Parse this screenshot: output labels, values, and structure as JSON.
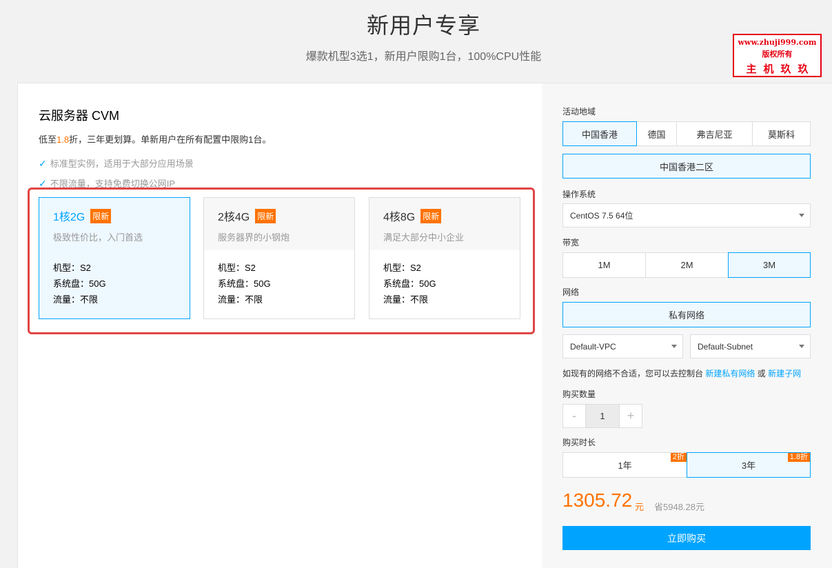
{
  "hero": {
    "title": "新用户专享",
    "subtitle": "爆款机型3选1，新用户限购1台，100%CPU性能"
  },
  "watermark": {
    "line1": "www.zhuji999.com",
    "line2": "版权所有",
    "line3": "主机玖玖"
  },
  "product": {
    "title": "云服务器 CVM",
    "desc_pre": "低至",
    "desc_discount": "1.8",
    "desc_post": "折，三年更划算。单新用户在所有配置中限购1台。",
    "features": [
      "标准型实例，适用于大部分应用场景",
      "不限流量，支持免费切换公网IP"
    ]
  },
  "packages": [
    {
      "name": "1核2G",
      "badge": "限新",
      "subtitle": "极致性价比，入门首选",
      "model": "机型：S2",
      "disk": "系统盘：50G",
      "traffic": "流量：不限",
      "selected": true
    },
    {
      "name": "2核4G",
      "badge": "限新",
      "subtitle": "服务器界的小钢炮",
      "model": "机型：S2",
      "disk": "系统盘：50G",
      "traffic": "流量：不限",
      "selected": false
    },
    {
      "name": "4核8G",
      "badge": "限新",
      "subtitle": "满足大部分中小企业",
      "model": "机型：S2",
      "disk": "系统盘：50G",
      "traffic": "流量：不限",
      "selected": false
    }
  ],
  "config": {
    "region_label": "活动地域",
    "regions": [
      "中国香港",
      "德国",
      "弗吉尼亚",
      "莫斯科"
    ],
    "zone": "中国香港二区",
    "os_label": "操作系统",
    "os_value": "CentOS 7.5 64位",
    "bandwidth_label": "带宽",
    "bandwidths": [
      "1M",
      "2M",
      "3M"
    ],
    "network_label": "网络",
    "network_type": "私有网络",
    "vpc": "Default-VPC",
    "subnet": "Default-Subnet",
    "note_pre": "如现有的网络不合适，您可以去控制台",
    "note_link1": "新建私有网络",
    "note_or": "或",
    "note_link2": "新建子网",
    "qty_label": "购买数量",
    "qty_minus": "-",
    "qty_value": "1",
    "qty_plus": "+",
    "duration_label": "购买时长",
    "durations": [
      {
        "label": "1年",
        "badge": "2折"
      },
      {
        "label": "3年",
        "badge": "1.8折"
      }
    ],
    "price": "1305.72",
    "price_unit": "元",
    "save": "省5948.28元",
    "buy": "立即购买"
  },
  "colors": {
    "accent": "#00a4ff",
    "orange": "#ff7200",
    "highlight_border": "#e04545"
  }
}
